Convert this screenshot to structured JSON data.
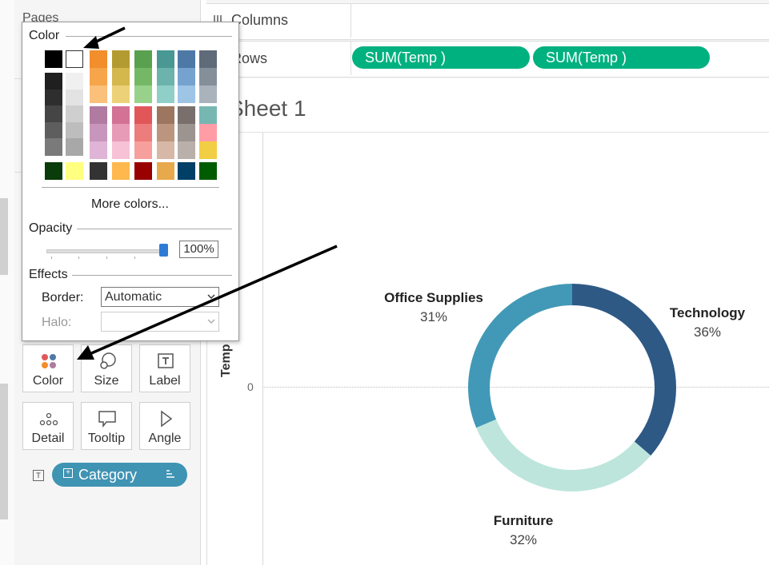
{
  "sidebar": {
    "pages_label": "Pages",
    "marks": {
      "color_label": "Color",
      "size_label": "Size",
      "label_label": "Label",
      "detail_label": "Detail",
      "tooltip_label": "Tooltip",
      "angle_label": "Angle"
    },
    "category_pill": "Category"
  },
  "shelves": {
    "columns_label": "Columns",
    "rows_label": "Rows",
    "rows_pills": [
      "SUM(Temp )",
      "SUM(Temp )"
    ]
  },
  "sheet": {
    "title": "Sheet 1",
    "axis_title": "Temp",
    "zero_tick": "0"
  },
  "chart_data": {
    "type": "pie",
    "categories": [
      "Technology",
      "Furniture",
      "Office Supplies"
    ],
    "values": [
      36,
      32,
      31
    ],
    "labels": [
      "36%",
      "32%",
      "31%"
    ],
    "colors": [
      "#2e5985",
      "#bde5dc",
      "#4299b7"
    ],
    "legend": "none",
    "donut": true
  },
  "color_popup": {
    "color_title": "Color",
    "more_colors": "More colors...",
    "opacity_title": "Opacity",
    "opacity_value": "100%",
    "opacity_fraction": 1.0,
    "effects_title": "Effects",
    "border_label": "Border:",
    "border_value": "Automatic",
    "halo_label": "Halo:",
    "halo_value": "",
    "palette": {
      "top_pair": [
        "#000000",
        "#ffffff"
      ],
      "gray_columns": [
        [
          "#1f1f1f",
          "#2e2e2e",
          "#454545",
          "#5e5e5e",
          "#7a7a7a"
        ],
        [
          "#f0f0f0",
          "#e3e3e3",
          "#cfcfcf",
          "#bdbdbd",
          "#a8a8a8"
        ]
      ],
      "upper_columns": [
        [
          "#f28e2b",
          "#f7a54a",
          "#fbc07a"
        ],
        [
          "#b49b31",
          "#d4b74d",
          "#edd179"
        ],
        [
          "#59a14f",
          "#74b865",
          "#98d28a"
        ],
        [
          "#499894",
          "#6cb3ad",
          "#8fcfc8"
        ],
        [
          "#4e79a7",
          "#76a2cf",
          "#9ec4e6"
        ],
        [
          "#5f6b78",
          "#848f9a",
          "#aab3bb"
        ]
      ],
      "lower_columns": [
        [
          "#b07aa1",
          "#c896bd",
          "#dfb4d6"
        ],
        [
          "#d37295",
          "#e79bb7",
          "#f7c2d6"
        ],
        [
          "#e15759",
          "#ed7d7c",
          "#f79f9c"
        ],
        [
          "#9d7660",
          "#bc957e",
          "#d7b8a6"
        ],
        [
          "#79706e",
          "#9c9490",
          "#bab0ab"
        ],
        [
          "#76b7b2",
          "#ff9da7",
          "#f1ce44"
        ]
      ],
      "bottom_row": [
        "#0a3b0a",
        "#ffff80",
        "#333333",
        "#ffb84d",
        "#990000",
        "#e8a84c",
        "#003f66",
        "#005c00"
      ]
    }
  }
}
